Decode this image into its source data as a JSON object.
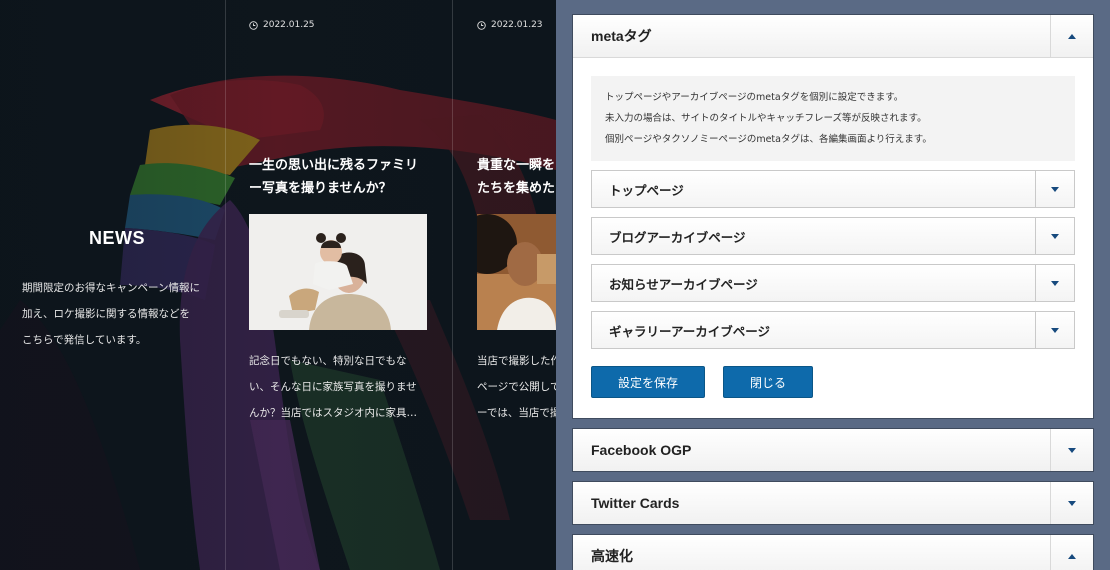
{
  "preview": {
    "news": {
      "title": "NEWS",
      "description_lines": [
        "期間限定のお得なキャンペーン情報に",
        "加え、ロケ撮影に関する情報などを",
        "こちらで発信しています。"
      ]
    },
    "posts": [
      {
        "date": "2022.01.25",
        "title_lines": [
          "一生の思い出に残るファミリ",
          "ー写真を撮りませんか？"
        ],
        "excerpt_lines": [
          "記念日でもない、特別な日でもな",
          "い、そんな日に家族写真を撮りませ",
          "んか？当店ではスタジオ内に家具…"
        ]
      },
      {
        "date": "2022.01.23",
        "title_lines": [
          "貴重な一瞬を",
          "たちを集めた"
        ],
        "excerpt_lines": [
          "当店で撮影した作",
          "ページで公開して",
          "ーでは、当店で撮"
        ]
      }
    ]
  },
  "settings": {
    "meta_section": {
      "title": "metaタグ",
      "notice_lines": [
        "トップページやアーカイブページのmetaタグを個別に設定できます。",
        "未入力の場合は、サイトのタイトルやキャッチフレーズ等が反映されます。",
        "個別ページやタクソノミーページのmetaタグは、各編集画面より行えます。"
      ],
      "sub_sections": [
        {
          "title": "トップページ"
        },
        {
          "title": "ブログアーカイブページ"
        },
        {
          "title": "お知らせアーカイブページ"
        },
        {
          "title": "ギャラリーアーカイブページ"
        }
      ],
      "save_label": "設定を保存",
      "close_label": "閉じる"
    },
    "sections": [
      {
        "title": "Facebook OGP",
        "state": "collapsed"
      },
      {
        "title": "Twitter Cards",
        "state": "collapsed"
      },
      {
        "title": "高速化",
        "state": "expanded"
      }
    ]
  },
  "colors": {
    "panel_bg": "#5a6a85",
    "button_blue": "#0e6aab",
    "toggle_arrow": "#174a7e",
    "preview_bg": "#0e161d"
  }
}
